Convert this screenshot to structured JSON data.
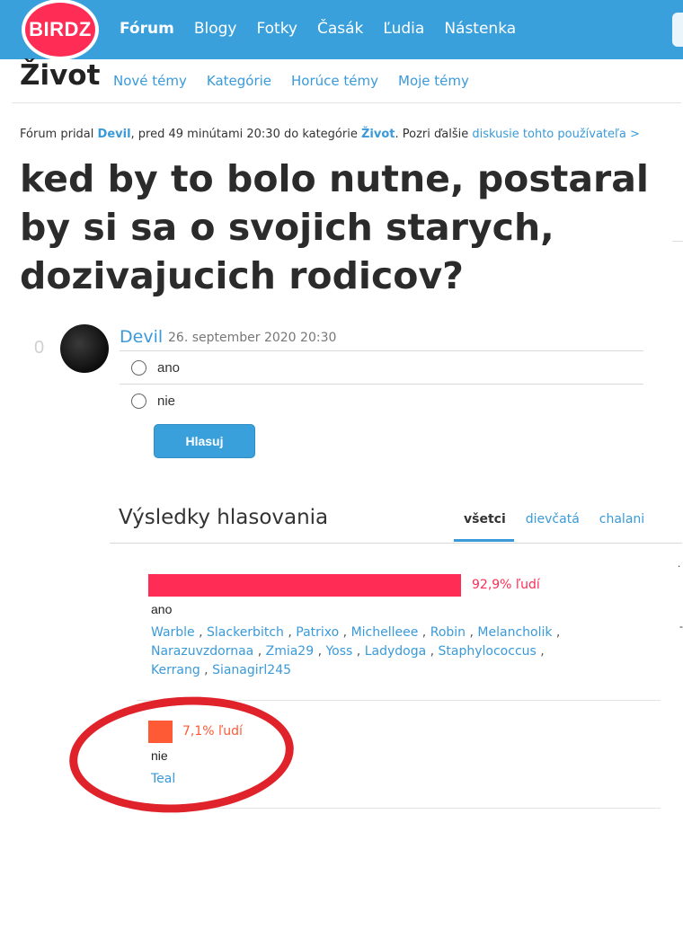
{
  "brand": {
    "logo_text": "BIRDZ",
    "primary_color": "#3aa0dc",
    "logo_color": "#ff2d55"
  },
  "nav": {
    "items": [
      "Fórum",
      "Blogy",
      "Fotky",
      "Časák",
      "Ľudia",
      "Nástenka"
    ],
    "active": "Fórum"
  },
  "subnav": {
    "section": "Život",
    "links": [
      "Nové témy",
      "Kategórie",
      "Horúce témy",
      "Moje témy"
    ]
  },
  "meta": {
    "prefix": "Fórum pridal",
    "author": "Devil",
    "time": ", pred 49 minútami 20:30 do kategórie",
    "category": "Život",
    "suffix": ". Pozri ďalšie",
    "link": "diskusie tohto používateľa >"
  },
  "title": "ked by to bolo nutne, postaral by si sa o svojich starych, dozivajucich rodicov?",
  "post": {
    "score": "0",
    "author": "Devil",
    "date": "26. september 2020 20:30",
    "options": [
      "ano",
      "nie"
    ],
    "vote_button": "Hlasuj"
  },
  "results": {
    "title": "Výsledky hlasovania",
    "tabs": [
      "všetci",
      "dievčatá",
      "chalani"
    ],
    "active_tab": "všetci",
    "items": [
      {
        "option": "ano",
        "percent_label": "92,9% ľudí",
        "percent": 92.9,
        "color": "#ff2d55",
        "voters": [
          "Warble",
          "Slackerbitch",
          "Patrixo",
          "Michelleee",
          "Robin",
          "Melancholik",
          "Narazuvzdornaa",
          "Zmia29",
          "Yoss",
          "Ladydoga",
          "Staphylococcus",
          "Kerrang",
          "Sianagirl245"
        ]
      },
      {
        "option": "nie",
        "percent_label": "7,1% ľudí",
        "percent": 7.1,
        "color": "#ff5a36",
        "voters": [
          "Teal"
        ]
      }
    ]
  },
  "annotation": {
    "color": "#e0232a"
  }
}
